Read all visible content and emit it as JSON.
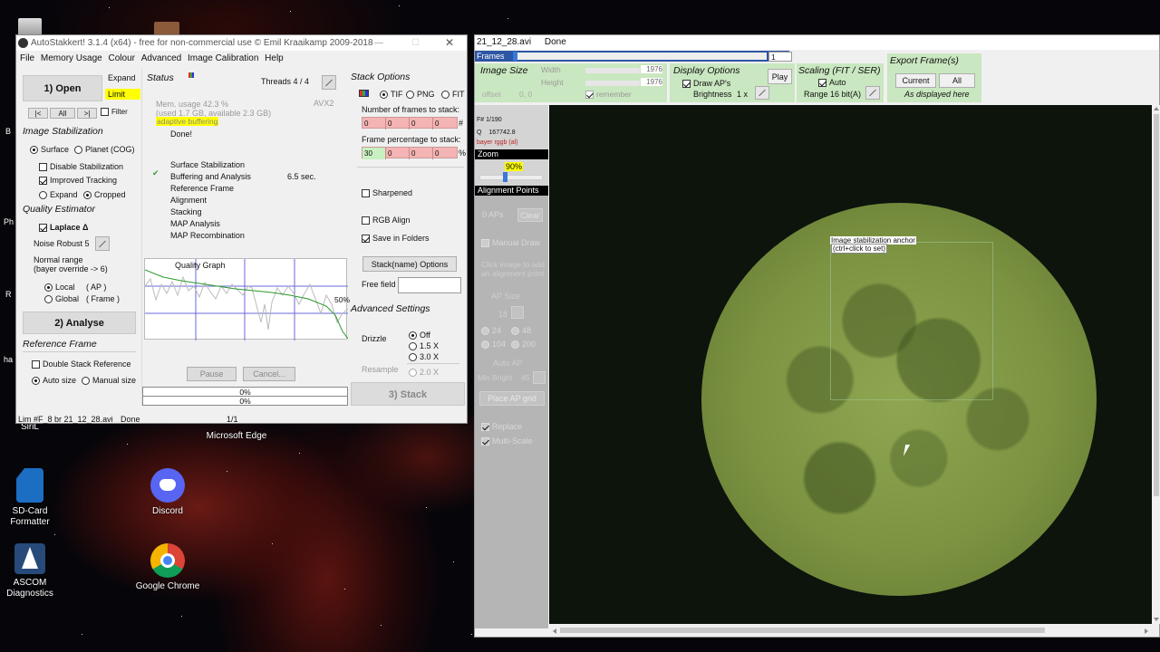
{
  "desktop": {
    "icons": [
      {
        "label": "SiriL",
        "color": "#3a5fa8"
      },
      {
        "label": "Microsoft Edge",
        "color": "#1f8fd8"
      },
      {
        "label": "SD-Card\nFormatter",
        "color": "#1b6ec2"
      },
      {
        "label": "Discord",
        "color": "#5865f2"
      },
      {
        "label": "ASCOM\nDiagnostics",
        "color": "#274a7a"
      },
      {
        "label": "Google Chrome",
        "color": "#dd4b39"
      }
    ],
    "edge_labels": {
      "b": "B",
      "ph": "Ph",
      "r": "R",
      "ha": "ha"
    }
  },
  "as": {
    "title": "AutoStakkert! 3.1.4 (x64) - free for non-commercial use © Emil Kraaikamp 2009-2018",
    "menu": [
      "File",
      "Memory Usage",
      "Colour",
      "Advanced",
      "Image Calibration",
      "Help"
    ],
    "open": "1) Open",
    "expand": "Expand",
    "limit": "Limit",
    "nav": {
      "prev": "|<",
      "all": "All",
      "next": ">|",
      "filter": "Filter"
    },
    "image_stab": {
      "title": "Image Stabilization",
      "surface": "Surface",
      "planet": "Planet (COG)",
      "disable": "Disable Stabilization",
      "improved": "Improved Tracking",
      "expand": "Expand",
      "cropped": "Cropped"
    },
    "quality": {
      "title": "Quality Estimator",
      "laplace": "Laplace Δ",
      "noise": "Noise Robust",
      "noise_val": "5",
      "normal": "Normal range",
      "bayer": "(bayer override -> 6)",
      "local": "Local",
      "local_v": "( AP )",
      "global": "Global",
      "global_v": "( Frame )"
    },
    "analyse": "2) Analyse",
    "ref": {
      "title": "Reference Frame",
      "double": "Double Stack Reference",
      "auto": "Auto size",
      "manual": "Manual size"
    },
    "status": {
      "title": "Status",
      "threads": "Threads 4 / 4",
      "mem": "Mem. usage 42.3 %",
      "mem2": "(used 1.7 GB, available 2.3 GB)",
      "avx": "AVX2",
      "adaptive": "adaptive buffering",
      "done": "Done!",
      "steps": [
        "Surface Stabilization",
        "Buffering and Analysis",
        "Reference Frame",
        "Alignment",
        "Stacking",
        "MAP Analysis",
        "MAP Recombination"
      ],
      "time": "6.5 sec.",
      "check": "✔"
    },
    "graph": {
      "title": "Quality Graph",
      "pct": "50%"
    },
    "pause": "Pause",
    "cancel": "Cancel...",
    "prog1": "0%",
    "prog2": "0%",
    "statusbar": {
      "file": "Lim #F_8 br 21_12_28.avi",
      "state": "Done",
      "count": "1/1"
    },
    "stack": {
      "title": "Stack Options",
      "tif": "TIF",
      "png": "PNG",
      "fit": "FIT",
      "nframes": "Number of frames to stack:",
      "nvals": [
        "0",
        "0",
        "0",
        "0"
      ],
      "hash": "#",
      "pctlabel": "Frame percentage to stack:",
      "pvals": [
        "30",
        "0",
        "0",
        "0"
      ],
      "pctsign": "%",
      "sharpened": "Sharpened",
      "rgb": "RGB Align",
      "folders": "Save in Folders",
      "nameopts": "Stack(name) Options",
      "freefield": "Free field"
    },
    "adv": {
      "title": "Advanced Settings",
      "drizzle": "Drizzle",
      "off": "Off",
      "d15": "1.5 X",
      "d30": "3.0 X",
      "resample": "Resample",
      "r20": "2.0 X",
      "stack": "3) Stack"
    }
  },
  "viewer": {
    "title": "21_12_28.avi",
    "state": "Done",
    "frames": {
      "label": "Frames",
      "value": "1"
    },
    "imgsize": {
      "title": "Image Size",
      "width": "Width",
      "width_v": "1976",
      "height": "Height",
      "height_v": "1976",
      "offset": "offset",
      "offset_v": "0, 0",
      "remember": "remember"
    },
    "display": {
      "title": "Display Options",
      "play": "Play",
      "draw": "Draw AP's",
      "bright": "Brightness",
      "bright_v": "1 x"
    },
    "scaling": {
      "title": "Scaling (FIT / SER)",
      "auto": "Auto",
      "range": "Range 16 bit(A)"
    },
    "export": {
      "title": "Export Frame(s)",
      "current": "Current",
      "all": "All",
      "asdisp": "As displayed here"
    },
    "info": {
      "frame": "F# 1/190",
      "q": "Q",
      "qv": "167742.8",
      "bayer": "bayer rggb (al)"
    },
    "zoom": {
      "title": "Zoom",
      "value": "90%"
    },
    "ap": {
      "title": "Alignment Points",
      "count": "0 APs",
      "clear": "Clear",
      "manual": "Manual Draw",
      "hint": "Click image to add an alignment point",
      "apsize": "AP Size",
      "size_v": "18",
      "s24": "24",
      "s48": "48",
      "s104": "104",
      "s200": "200",
      "autoap": "Auto AP",
      "minbright": "Min Bright",
      "minbright_v": "45",
      "place": "Place AP grid",
      "replace": "Replace",
      "multiscale": "Multi-Scale"
    },
    "anchor": {
      "label": "Image stabilization anchor",
      "hint": "(ctrl+click to set)"
    }
  }
}
